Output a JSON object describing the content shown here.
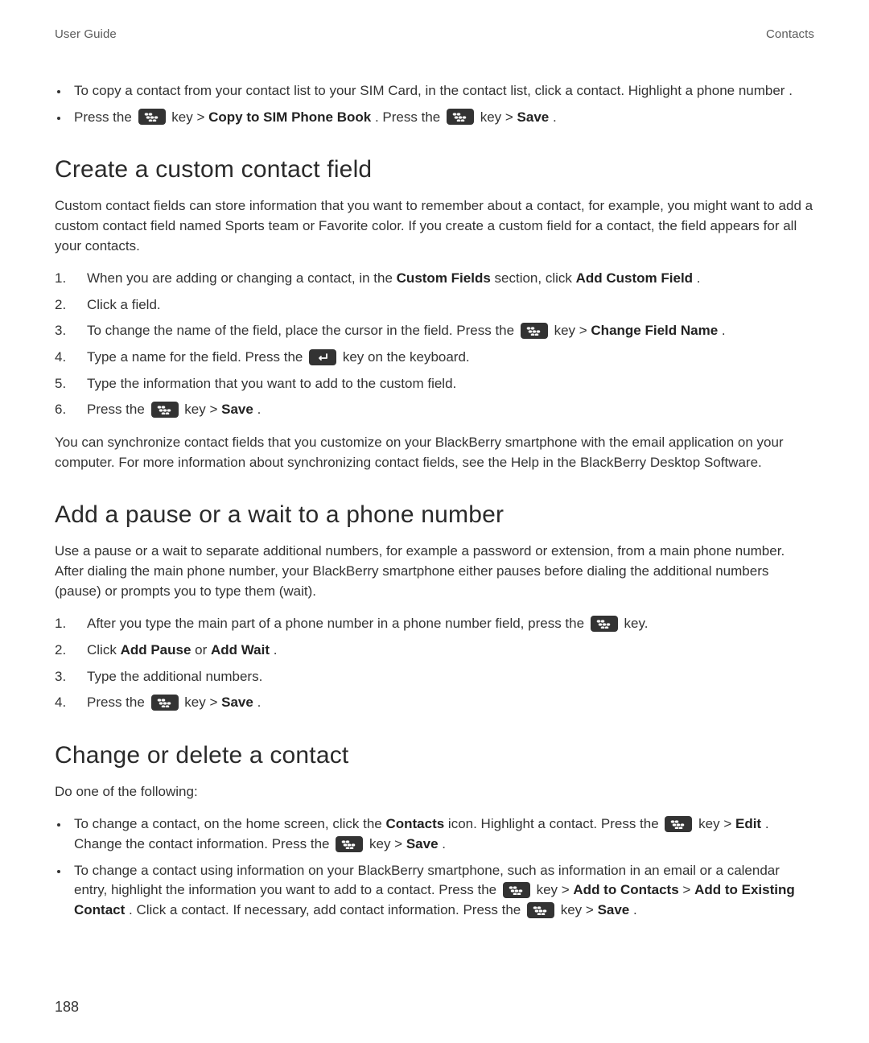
{
  "header": {
    "left": "User Guide",
    "right": "Contacts"
  },
  "intro_bullets": {
    "b1": "To copy a contact from your contact list to your SIM Card, in the contact list, click a contact. Highlight a phone number .",
    "b2_a": "Press the ",
    "b2_b": " key > ",
    "b2_bold1": "Copy to SIM Phone Book",
    "b2_c": ". Press the ",
    "b2_d": " key > ",
    "b2_bold2": "Save",
    "b2_e": "."
  },
  "sec1": {
    "title": "Create a custom contact field",
    "intro": "Custom contact fields can store information that you want to remember about a contact, for example, you might want to add a custom contact field named Sports team or Favorite color. If you create a custom field for a contact, the field appears for all your contacts.",
    "step1_a": "When you are adding or changing a contact, in the ",
    "step1_bold1": "Custom Fields",
    "step1_b": " section, click ",
    "step1_bold2": "Add Custom Field",
    "step1_c": ".",
    "step2": "Click a field.",
    "step3_a": "To change the name of the field, place the cursor in the field. Press the ",
    "step3_b": " key > ",
    "step3_bold": "Change Field Name",
    "step3_c": ".",
    "step4_a": "Type a name for the field. Press the ",
    "step4_b": " key on the keyboard.",
    "step5": "Type the information that you want to add to the custom field.",
    "step6_a": "Press the ",
    "step6_b": " key > ",
    "step6_bold": "Save",
    "step6_c": ".",
    "outro": "You can synchronize contact fields that you customize on your BlackBerry smartphone with the email application on your computer. For more information about synchronizing contact fields, see the Help in the BlackBerry Desktop Software."
  },
  "sec2": {
    "title": "Add a pause or a wait to a phone number",
    "intro": "Use a pause or a wait to separate additional numbers, for example a password or extension, from a main phone number. After dialing the main phone number, your BlackBerry smartphone either pauses before dialing the additional numbers (pause) or prompts you to type them (wait).",
    "step1_a": "After you type the main part of a phone number in a phone number field, press the ",
    "step1_b": " key.",
    "step2_a": "Click ",
    "step2_bold1": "Add Pause",
    "step2_b": " or ",
    "step2_bold2": "Add Wait",
    "step2_c": ".",
    "step3": "Type the additional numbers.",
    "step4_a": "Press the ",
    "step4_b": " key > ",
    "step4_bold": "Save",
    "step4_c": "."
  },
  "sec3": {
    "title": "Change or delete a contact",
    "intro": "Do one of the following:",
    "b1_a": "To change a contact, on the home screen, click the ",
    "b1_bold1": "Contacts",
    "b1_b": " icon. Highlight a contact. Press the ",
    "b1_c": " key > ",
    "b1_bold2": "Edit",
    "b1_d": ". Change the contact information. Press the ",
    "b1_e": " key > ",
    "b1_bold3": "Save",
    "b1_f": ".",
    "b2_a": "To change a contact using information on your BlackBerry smartphone, such as information in an email or a calendar entry, highlight the information you want to add to a contact. Press the ",
    "b2_b": " key > ",
    "b2_bold1": "Add to Contacts",
    "b2_gt": " > ",
    "b2_bold2": "Add to Existing Contact",
    "b2_c": ". Click a contact. If necessary, add contact information. Press the ",
    "b2_d": " key > ",
    "b2_bold3": "Save",
    "b2_e": "."
  },
  "nums": {
    "n1": "1.",
    "n2": "2.",
    "n3": "3.",
    "n4": "4.",
    "n5": "5.",
    "n6": "6."
  },
  "page_number": "188"
}
